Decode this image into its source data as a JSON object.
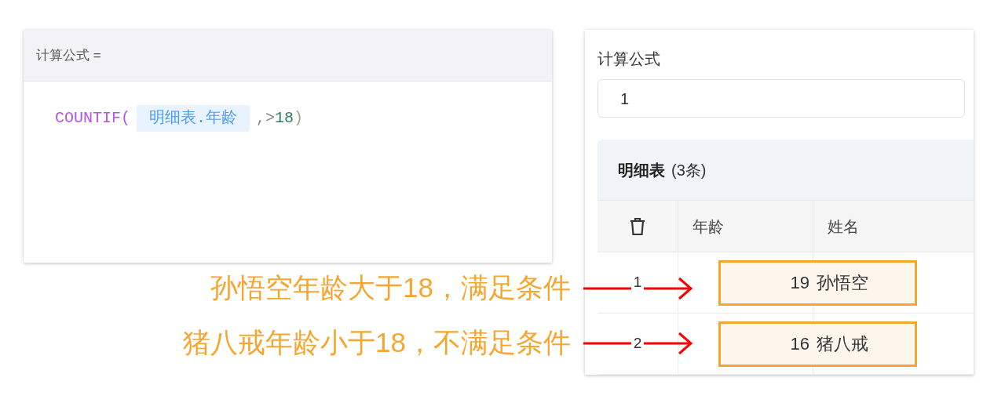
{
  "formula_editor": {
    "label": "计算公式 =",
    "tokens": [
      {
        "kind": "function",
        "text": "COUNTIF("
      },
      {
        "kind": "field",
        "text": "明细表.年龄"
      },
      {
        "kind": "operator",
        "text": ",>"
      },
      {
        "kind": "number",
        "text": "18"
      },
      {
        "kind": "paren",
        "text": ")"
      }
    ]
  },
  "form": {
    "label": "计算公式",
    "value": "1",
    "subtable": {
      "title": "明细表",
      "count": "(3条)",
      "columns": [
        "年龄",
        "姓名"
      ],
      "rows": [
        {
          "index": "1",
          "age": "19",
          "name": "孙悟空",
          "highlighted": true
        },
        {
          "index": "2",
          "age": "16",
          "name": "猪八戒",
          "highlighted": true
        }
      ]
    }
  },
  "annotations": [
    {
      "text": "孙悟空年龄大于18，满足条件"
    },
    {
      "text": "猪八戒年龄小于18，不满足条件"
    }
  ]
}
